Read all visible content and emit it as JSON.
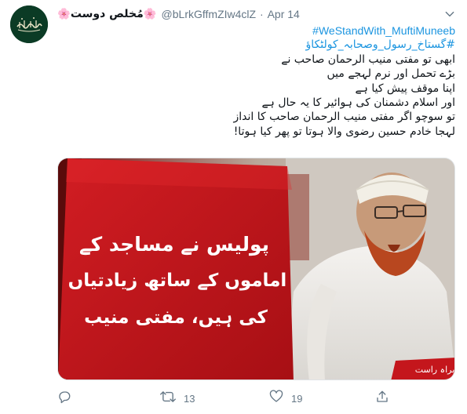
{
  "tweet": {
    "author": {
      "display_name": "مُخلص دوست",
      "name_emoji": "🌸",
      "handle": "@bLrkGffmZIw4clZ",
      "avatar_icon": "calligraphy-avatar-icon"
    },
    "separator": "·",
    "date": "Apr 14",
    "more_icon": "chevron-down-icon",
    "hashtags": {
      "english": "#WeStandWith_MuftiMuneeb",
      "urdu": "#گستاخ_رسول_وصحابہ_کولٹکاؤ"
    },
    "lines": [
      "ابھی تو مفتی منیب الرحمان صاحب نے",
      "بڑے تحمل اور نرم لہجے میں",
      "اپنا موقف پیش کیا ہے",
      "اور اسلام دشمنان کی ہوائیر کا یہ حال ہے",
      "تو سوچو اگر مفتی منیب الرحمان صاحب کا انداز",
      "لہجا خادم حسین رضوی والا ہوتا تو پھر کیا ہوتا!"
    ],
    "media": {
      "caption_lines": [
        "پولیس نے مساجد کے",
        "اماموں کے ساتھ زیادتیاں",
        "کی ہیں، مفتی منیب"
      ],
      "ticker_text": "براہ راست",
      "caption_color": "#c4161c"
    },
    "actions": {
      "reply": {
        "icon": "reply-icon",
        "count": ""
      },
      "retweet": {
        "icon": "retweet-icon",
        "count": "13"
      },
      "like": {
        "icon": "heart-icon",
        "count": "19"
      },
      "share": {
        "icon": "share-icon",
        "count": ""
      }
    },
    "colors": {
      "link": "#1b95e0",
      "muted": "#657786",
      "text": "#0f1419"
    }
  }
}
